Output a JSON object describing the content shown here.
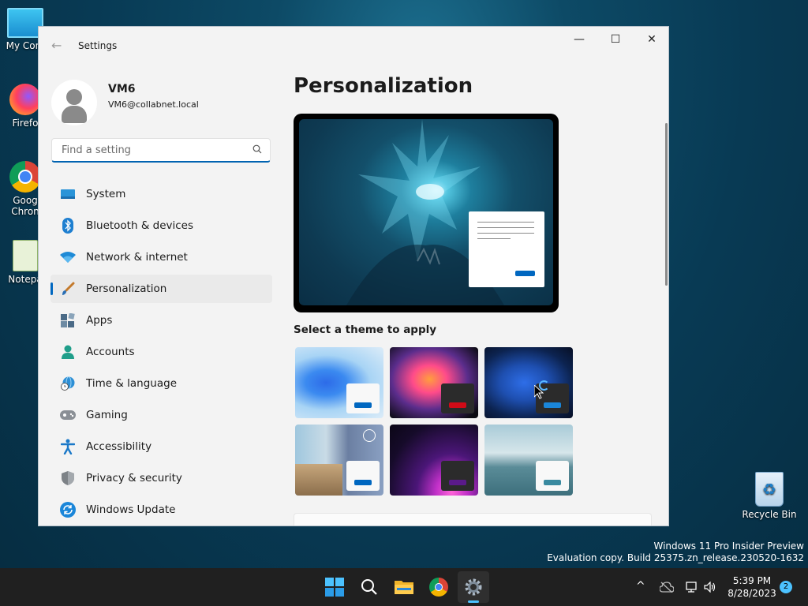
{
  "desktop": {
    "icons": [
      {
        "label": "My Com"
      },
      {
        "label": "Firefo"
      },
      {
        "label": "Goog Chron"
      },
      {
        "label": "Notepa"
      }
    ],
    "recycle_bin": "Recycle Bin",
    "watermark_line1": "Windows 11 Pro Insider Preview",
    "watermark_line2": "Evaluation copy. Build 25375.zn_release.230520-1632"
  },
  "window": {
    "title": "Settings",
    "controls": {
      "minimize": "—",
      "maximize": "☐",
      "close": "✕"
    }
  },
  "profile": {
    "name": "VM6",
    "email": "VM6@collabnet.local"
  },
  "search": {
    "placeholder": "Find a setting"
  },
  "nav": {
    "items": [
      {
        "label": "System",
        "icon": "monitor-icon"
      },
      {
        "label": "Bluetooth & devices",
        "icon": "bluetooth-icon"
      },
      {
        "label": "Network & internet",
        "icon": "wifi-icon"
      },
      {
        "label": "Personalization",
        "icon": "paintbrush-icon",
        "active": true
      },
      {
        "label": "Apps",
        "icon": "apps-icon"
      },
      {
        "label": "Accounts",
        "icon": "person-icon"
      },
      {
        "label": "Time & language",
        "icon": "globe-clock-icon"
      },
      {
        "label": "Gaming",
        "icon": "gamepad-icon"
      },
      {
        "label": "Accessibility",
        "icon": "accessibility-icon"
      },
      {
        "label": "Privacy & security",
        "icon": "shield-icon"
      },
      {
        "label": "Windows Update",
        "icon": "update-icon"
      }
    ]
  },
  "main": {
    "title": "Personalization",
    "theme_heading": "Select a theme to apply",
    "themes": [
      {
        "name": "theme-windows-light",
        "accent": "#0067c0"
      },
      {
        "name": "theme-glow",
        "accent": "#d10b17"
      },
      {
        "name": "theme-windows-dark",
        "accent": "#1a86d9"
      },
      {
        "name": "theme-flowers",
        "accent": "#0067c0"
      },
      {
        "name": "theme-captured-motion",
        "accent": "#5a1a8a"
      },
      {
        "name": "theme-sunrise",
        "accent": "#3a8aa0"
      }
    ]
  },
  "taskbar": {
    "apps": [
      "start-icon",
      "search-icon",
      "file-explorer-icon",
      "chrome-icon",
      "settings-icon"
    ],
    "time": "5:39 PM",
    "date": "8/28/2023",
    "notification_count": "2"
  },
  "colors": {
    "accent": "#0067c0",
    "window_bg": "#f3f3f3",
    "taskbar_bg": "#202020"
  }
}
